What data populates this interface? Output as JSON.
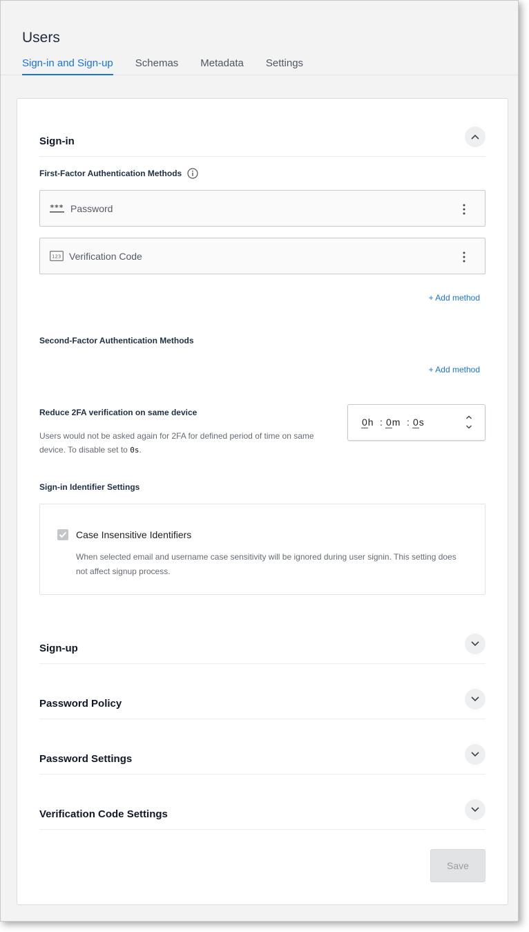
{
  "page": {
    "title": "Users"
  },
  "tabs": [
    {
      "label": "Sign-in and Sign-up",
      "active": true
    },
    {
      "label": "Schemas",
      "active": false
    },
    {
      "label": "Metadata",
      "active": false
    },
    {
      "label": "Settings",
      "active": false
    }
  ],
  "signin": {
    "title": "Sign-in",
    "first_factor": {
      "title": "First-Factor Authentication Methods",
      "methods": [
        {
          "label": "Password",
          "icon": "password-icon"
        },
        {
          "label": "Verification Code",
          "icon": "numeric-123-icon"
        }
      ],
      "add_label": "+ Add method"
    },
    "second_factor": {
      "title": "Second-Factor Authentication Methods",
      "add_label": "+ Add method"
    },
    "reduce_2fa": {
      "title": "Reduce 2FA verification on same device",
      "description": "Users would not be asked again for 2FA for defined period of time on same device. To disable set to",
      "code": "0s",
      "description_end": ".",
      "time": {
        "h": "0",
        "m": "0",
        "s": "0",
        "h_unit": "h",
        "m_unit": "m",
        "s_unit": "s",
        "sep": ":"
      }
    },
    "identifier": {
      "title": "Sign-in Identifier Settings",
      "checkbox_label": "Case Insensitive Identifiers",
      "checked": true,
      "description": "When selected email and username case sensitivity will be ignored during user signin. This setting does not affect signup process."
    }
  },
  "sections": [
    {
      "title": "Sign-up"
    },
    {
      "title": "Password Policy"
    },
    {
      "title": "Password Settings"
    },
    {
      "title": "Verification Code Settings"
    }
  ],
  "save_label": "Save",
  "colors": {
    "accent": "#1a73d9",
    "disabled_button": "#e2e3e5",
    "checkbox": "#c4c6ca"
  }
}
